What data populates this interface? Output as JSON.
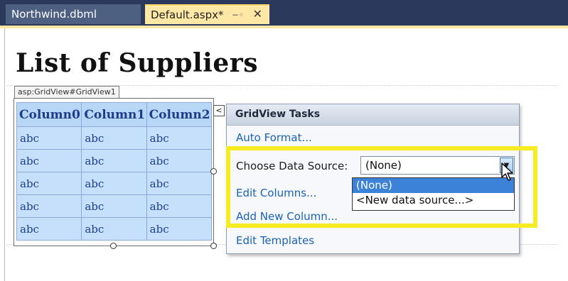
{
  "tabs": [
    {
      "label": "Northwind.dbml",
      "active": false
    },
    {
      "label": "Default.aspx*",
      "active": true
    }
  ],
  "tab_icons": {
    "pin": "pin-icon",
    "close": "close-icon"
  },
  "page": {
    "title": "List of Suppliers",
    "control_tag": "asp:GridView#GridView1"
  },
  "grid": {
    "columns": [
      "Column0",
      "Column1",
      "Column2"
    ],
    "rows": [
      [
        "abc",
        "abc",
        "abc"
      ],
      [
        "abc",
        "abc",
        "abc"
      ],
      [
        "abc",
        "abc",
        "abc"
      ],
      [
        "abc",
        "abc",
        "abc"
      ],
      [
        "abc",
        "abc",
        "abc"
      ]
    ]
  },
  "smart_tag": {
    "glyph": "<"
  },
  "tasks": {
    "header": "GridView Tasks",
    "auto_format": "Auto Format...",
    "choose_ds_label": "Choose Data Source:",
    "choose_ds_value": "(None)",
    "ds_options": [
      "(None)",
      "<New data source...>"
    ],
    "edit_columns": "Edit Columns...",
    "add_new_column": "Add New Column...",
    "edit_templates": "Edit Templates"
  },
  "colors": {
    "highlight": "#f7ec22",
    "link": "#1a62b8",
    "grid_header": "#b8d7f7",
    "grid_cell": "#c6e0fb",
    "tab_active": "#ffe8a6"
  }
}
